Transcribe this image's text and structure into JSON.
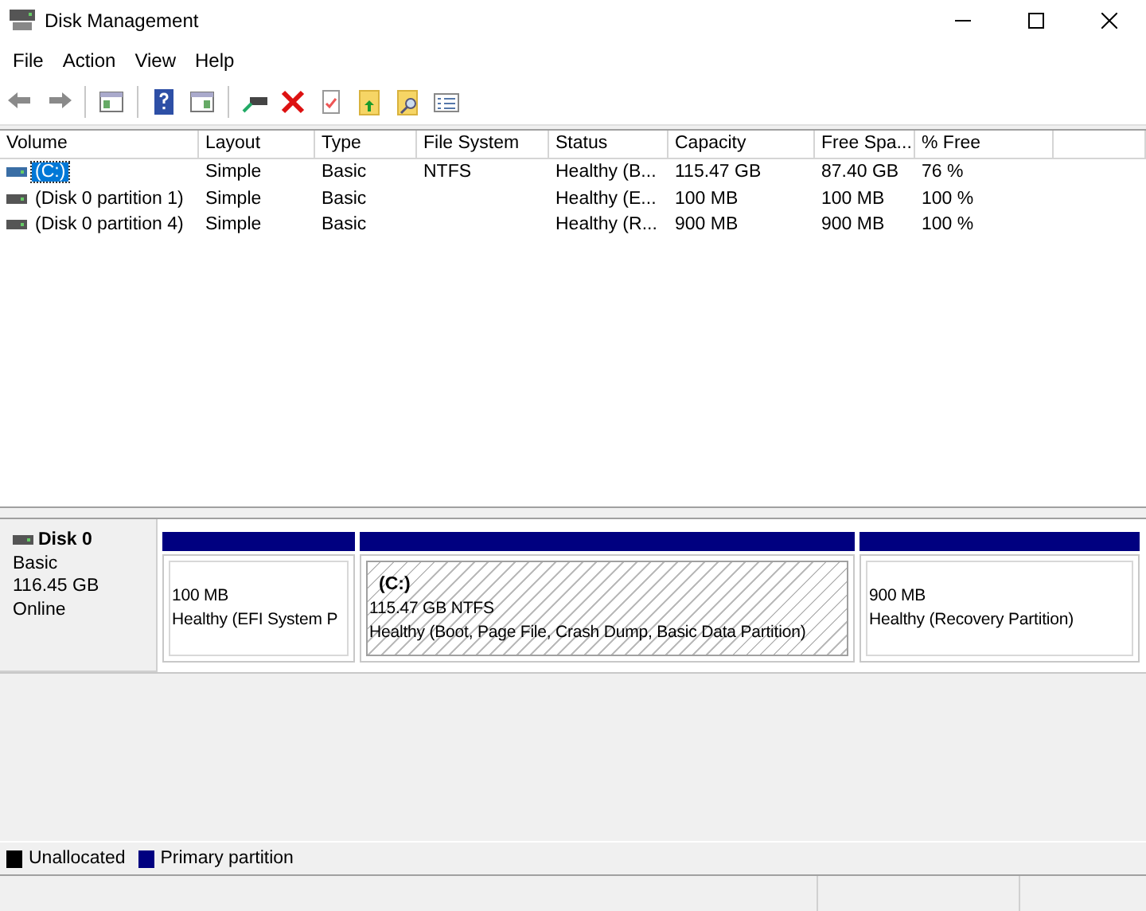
{
  "window": {
    "title": "Disk Management"
  },
  "menu": [
    "File",
    "Action",
    "View",
    "Help"
  ],
  "table": {
    "columns": [
      "Volume",
      "Layout",
      "Type",
      "File System",
      "Status",
      "Capacity",
      "Free Spa...",
      "% Free"
    ],
    "rows": [
      {
        "selected": true,
        "cells": [
          "(C:)",
          "Simple",
          "Basic",
          "NTFS",
          "Healthy (B...",
          "115.47 GB",
          "87.40 GB",
          "76 %"
        ]
      },
      {
        "selected": false,
        "cells": [
          "(Disk 0 partition 1)",
          "Simple",
          "Basic",
          "",
          "Healthy (E...",
          "100 MB",
          "100 MB",
          "100 %"
        ]
      },
      {
        "selected": false,
        "cells": [
          "(Disk 0 partition 4)",
          "Simple",
          "Basic",
          "",
          "Healthy (R...",
          "900 MB",
          "900 MB",
          "100 %"
        ]
      }
    ]
  },
  "disks": [
    {
      "name": "Disk 0",
      "type": "Basic",
      "size": "116.45 GB",
      "state": "Online",
      "partitions": [
        {
          "selected": false,
          "size": "100 MB",
          "status": "Healthy (EFI System P"
        },
        {
          "selected": true,
          "label": "(C:)",
          "size": "115.47 GB NTFS",
          "status": "Healthy (Boot, Page File, Crash Dump, Basic Data Partition)"
        },
        {
          "selected": false,
          "size": "900 MB",
          "status": "Healthy (Recovery Partition)"
        }
      ]
    }
  ],
  "legend": [
    {
      "label": "Unallocated",
      "color": "#000000"
    },
    {
      "label": "Primary partition",
      "color": "#000080"
    }
  ]
}
